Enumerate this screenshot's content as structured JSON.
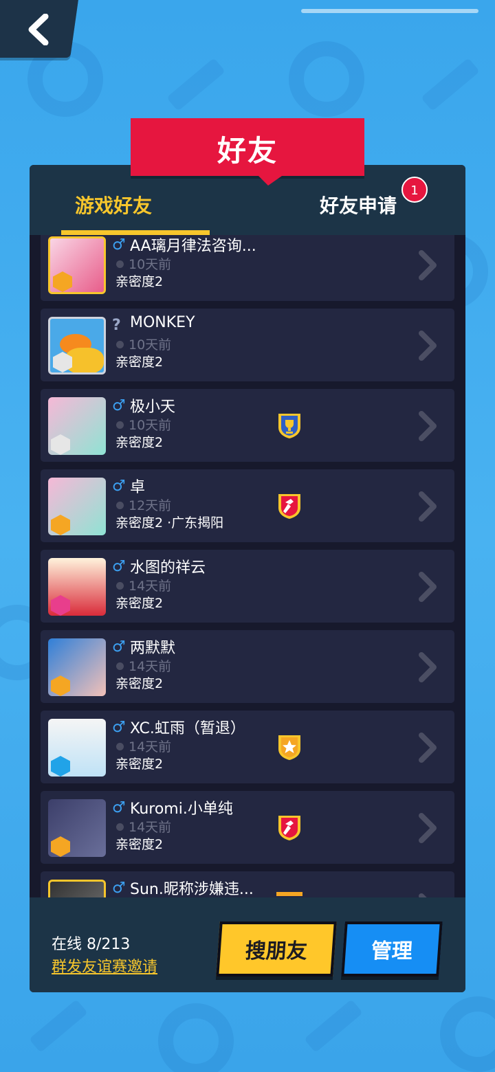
{
  "title": "好友",
  "tabs": {
    "game_friends": "游戏好友",
    "friend_requests": "好友申请",
    "request_badge": "1"
  },
  "friends": [
    {
      "gender": "♂",
      "name": "AA璃月律法咨询...",
      "time": "10天前",
      "intimacy": "亲密度2",
      "icon": "pink-anime-girl-avatar",
      "rank": "gold",
      "shield": ""
    },
    {
      "gender": "?",
      "name": "MONKEY",
      "time": "10天前",
      "intimacy": "亲密度2",
      "icon": "orange-duck-avatar",
      "rank": "silver",
      "shield": ""
    },
    {
      "gender": "♂",
      "name": "极小天",
      "time": "10天前",
      "intimacy": "亲密度2",
      "icon": "white-hair-boy-avatar",
      "rank": "silver",
      "shield": "trophy"
    },
    {
      "gender": "♂",
      "name": "卓",
      "time": "12天前",
      "intimacy": "亲密度2 ·广东揭阳",
      "icon": "bald-man-avatar",
      "rank": "gold",
      "shield": "hammer"
    },
    {
      "gender": "♂",
      "name": "水图的祥云",
      "time": "14天前",
      "intimacy": "亲密度2",
      "icon": "lion-dance-avatar",
      "rank": "pink",
      "shield": ""
    },
    {
      "gender": "♂",
      "name": "两默默",
      "time": "14天前",
      "intimacy": "亲密度2",
      "icon": "red-hair-girl-avatar",
      "rank": "gold",
      "shield": ""
    },
    {
      "gender": "♂",
      "name": "XC.虹雨（暂退）",
      "time": "14天前",
      "intimacy": "亲密度2",
      "icon": "maid-girl-avatar",
      "rank": "blue",
      "shield": "star"
    },
    {
      "gender": "♂",
      "name": "Kuromi.小单纯",
      "time": "14天前",
      "intimacy": "亲密度2",
      "icon": "dinosaur-avatar",
      "rank": "gold",
      "shield": "hammer"
    },
    {
      "gender": "♂",
      "name": "Sun.昵称涉嫌违...",
      "time": "",
      "intimacy": "",
      "icon": "dark-avatar",
      "rank": "",
      "shield": "partial"
    }
  ],
  "footer": {
    "online": "在线 8/213",
    "invite": "群发友谊赛邀请",
    "search_button": "搜朋友",
    "manage_button": "管理"
  },
  "colors": {
    "accent_yellow": "#f7c62c",
    "title_red": "#e6163f",
    "manage_blue": "#168ef4",
    "panel_bg": "#17192c"
  }
}
